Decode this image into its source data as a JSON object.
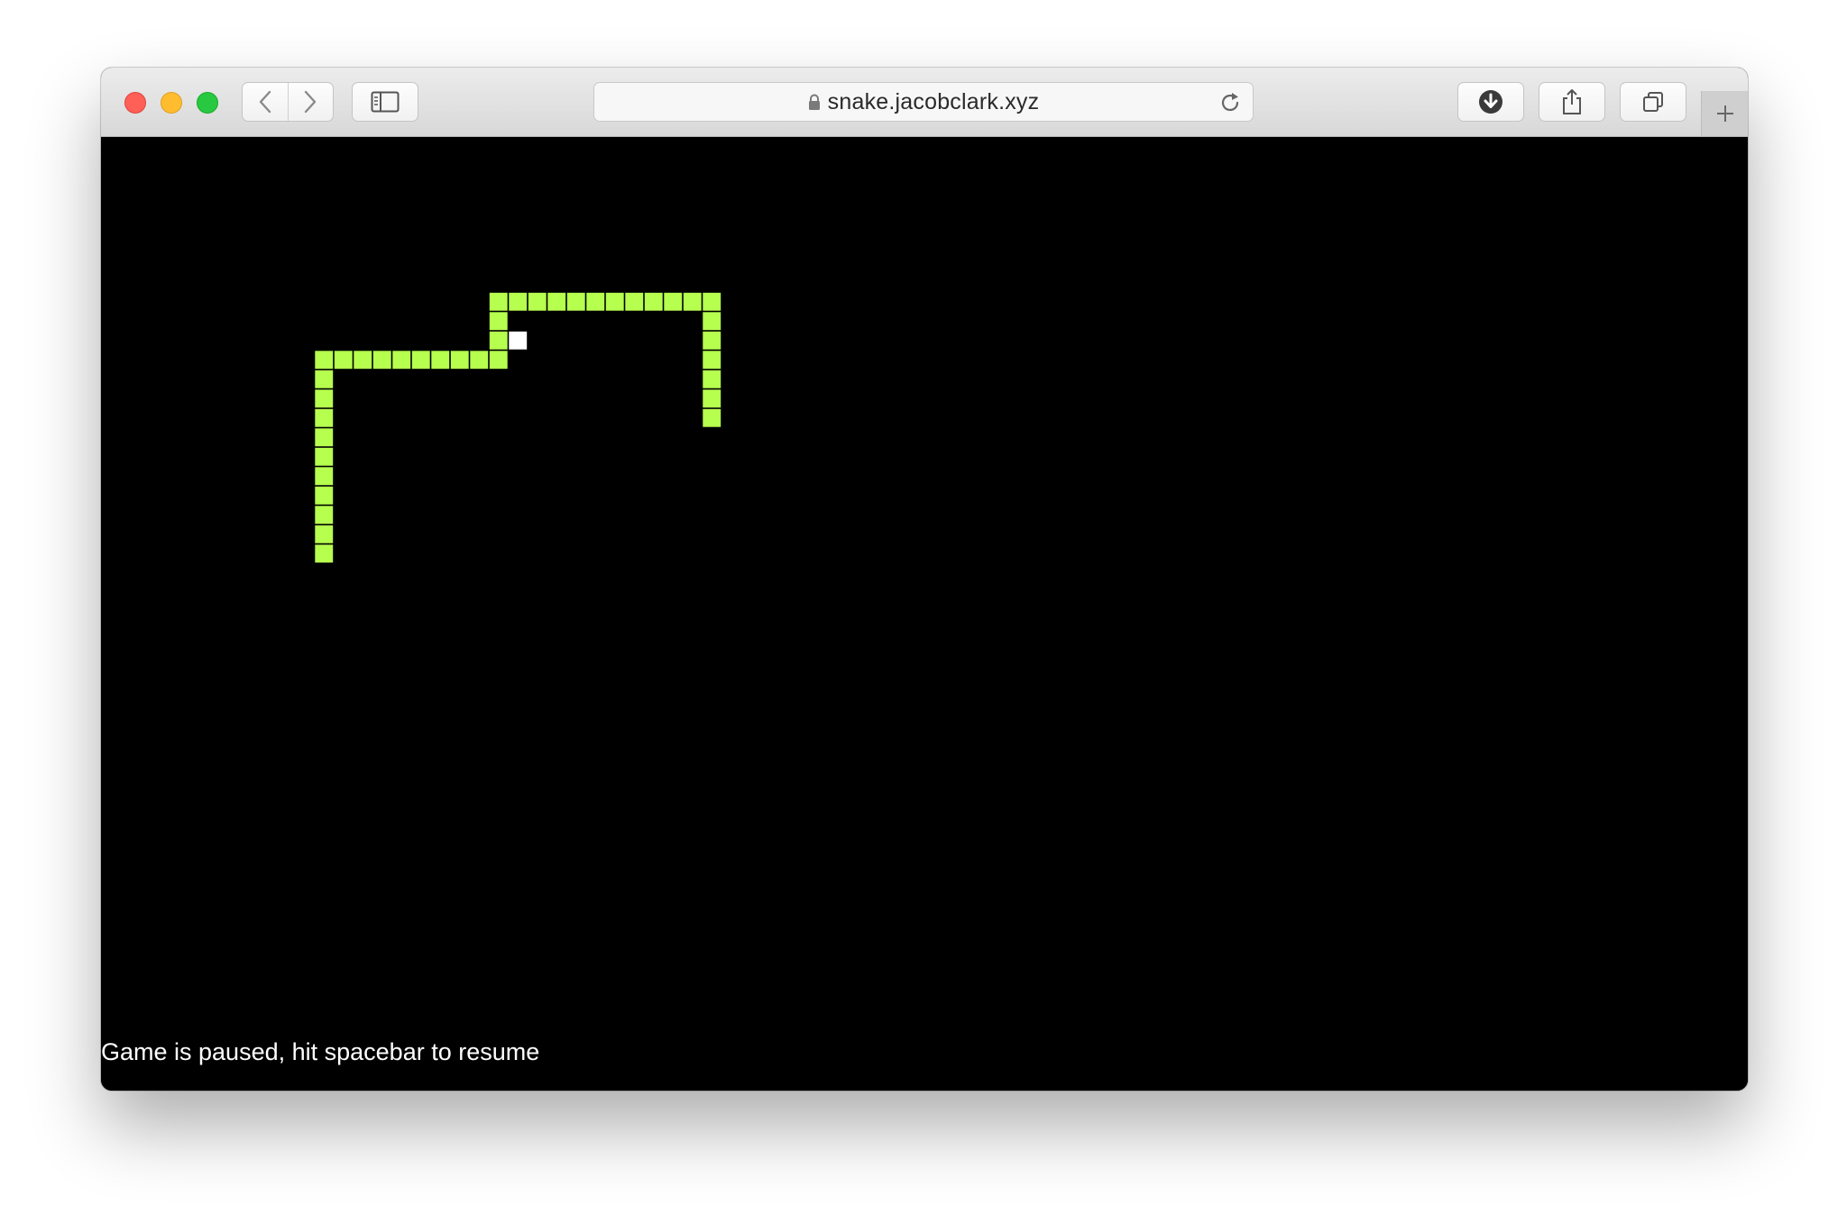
{
  "browser": {
    "url": "snake.jacobclark.xyz",
    "icons": {
      "close": "close-dot",
      "minimize": "minimize-dot",
      "maximize": "maximize-dot",
      "back": "chevron-left-icon",
      "forward": "chevron-right-icon",
      "sidebar": "sidebar-icon",
      "lock": "lock-icon",
      "reload": "reload-icon",
      "download": "download-icon",
      "share": "share-icon",
      "tabs": "tabs-overview-icon",
      "new_tab": "plus-icon"
    }
  },
  "game": {
    "status_text": "Game is paused, hit spacebar to resume",
    "grid_columns": 85,
    "grid_rows": 48,
    "colors": {
      "background": "#000000",
      "snake": "#b6ff4f",
      "food": "#ffffff",
      "text": "#ffffff"
    },
    "snake_cells": [
      [
        11,
        21
      ],
      [
        11,
        20
      ],
      [
        11,
        19
      ],
      [
        11,
        18
      ],
      [
        11,
        17
      ],
      [
        11,
        16
      ],
      [
        11,
        15
      ],
      [
        11,
        14
      ],
      [
        11,
        13
      ],
      [
        11,
        12
      ],
      [
        11,
        11
      ],
      [
        12,
        11
      ],
      [
        13,
        11
      ],
      [
        14,
        11
      ],
      [
        15,
        11
      ],
      [
        16,
        11
      ],
      [
        17,
        11
      ],
      [
        18,
        11
      ],
      [
        19,
        11
      ],
      [
        20,
        11
      ],
      [
        20,
        10
      ],
      [
        20,
        9
      ],
      [
        20,
        8
      ],
      [
        21,
        8
      ],
      [
        22,
        8
      ],
      [
        23,
        8
      ],
      [
        24,
        8
      ],
      [
        25,
        8
      ],
      [
        26,
        8
      ],
      [
        27,
        8
      ],
      [
        28,
        8
      ],
      [
        29,
        8
      ],
      [
        30,
        8
      ],
      [
        31,
        8
      ],
      [
        31,
        9
      ],
      [
        31,
        10
      ],
      [
        31,
        11
      ],
      [
        31,
        12
      ],
      [
        31,
        13
      ],
      [
        31,
        14
      ]
    ],
    "food_cell": [
      21,
      10
    ]
  }
}
